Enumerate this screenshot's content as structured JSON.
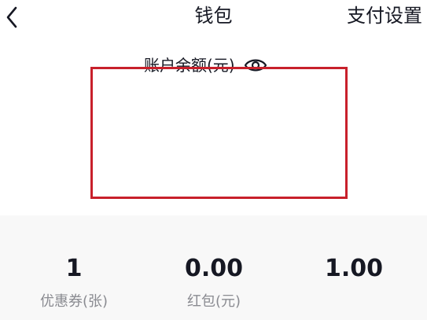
{
  "header": {
    "back_icon": "chevron-left-icon",
    "title": "钱包",
    "settings_label": "支付设置"
  },
  "balance": {
    "label": "账户余额(元)",
    "visibility_icon": "eye-icon",
    "highlight_color": "#c8202b"
  },
  "stats": [
    {
      "value": "1",
      "label": "优惠券(张)"
    },
    {
      "value": "0.00",
      "label": "红包(元)"
    },
    {
      "value": "1.00",
      "label": ""
    }
  ]
}
